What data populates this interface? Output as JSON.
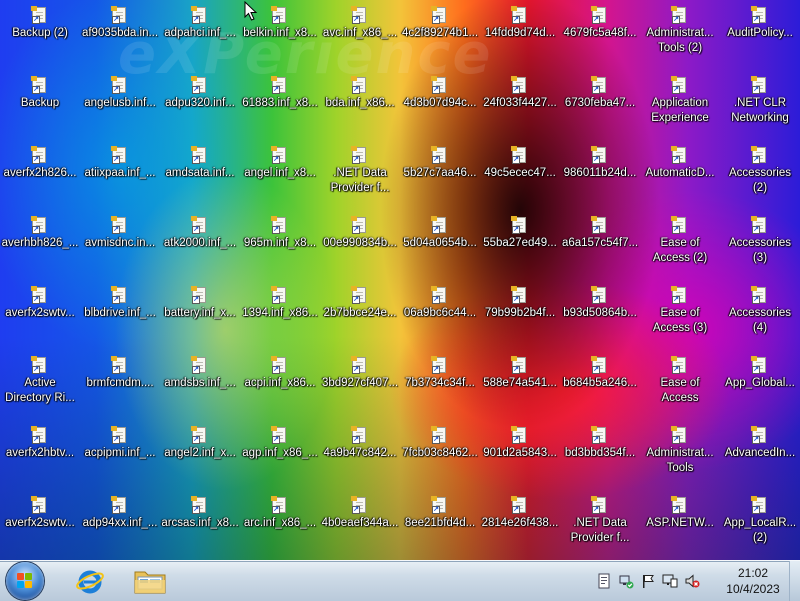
{
  "desktop": {
    "wallpaper_text": "eXPerience",
    "icons": [
      [
        "Backup (2)",
        "af9035bda.in...",
        "adpahci.inf_...",
        "belkin.inf_x8...",
        "avc.inf_x86_...",
        "4c2f89274b1...",
        "14fdd9d74d...",
        "4679fc5a48f...",
        "Administrat... Tools (2)",
        "AuditPolicy..."
      ],
      [
        "Backup",
        "angelusb.inf...",
        "adpu320.inf...",
        "61883.inf_x8...",
        "bda.inf_x86...",
        "4d3b07d94c...",
        "24f033f4427...",
        "6730feba47...",
        "Application Experience",
        ".NET CLR Networking"
      ],
      [
        "averfx2h826...",
        "atiixpaa.inf_...",
        "amdsata.inf...",
        "angel.inf_x8...",
        ".NET Data Provider f...",
        "5b27c7aa46...",
        "49c5ecec47...",
        "986011b24d...",
        "AutomaticD...",
        "Accessories (2)"
      ],
      [
        "averhbh826_...",
        "avmisdnc.in...",
        "atk2000.inf_...",
        "965m.inf_x8...",
        "00e990834b...",
        "5d04a0654b...",
        "55ba27ed49...",
        "a6a157c54f7...",
        "Ease of Access (2)",
        "Accessories (3)"
      ],
      [
        "averfx2swtv...",
        "blbdrive.inf_...",
        "battery.inf_x...",
        "1394.inf_x86...",
        "2b7bbce24e...",
        "06a9bc6c44...",
        "79b99b2b4f...",
        "b93d50864b...",
        "Ease of Access (3)",
        "Accessories (4)"
      ],
      [
        "Active Directory Ri...",
        "brmfcmdm....",
        "amdsbs.inf_...",
        "acpi.inf_x86...",
        "3bd927cf407...",
        "7b3734c34f...",
        "588e74a541...",
        "b684b5a246...",
        "Ease of Access",
        "App_Global..."
      ],
      [
        "averfx2hbtv...",
        "acpipmi.inf_...",
        "angel2.inf_x...",
        "agp.inf_x86_...",
        "4a9b47c842...",
        "7fcb03c8462...",
        "901d2a5843...",
        "bd3bbd354f...",
        "Administrat... Tools",
        "AdvancedIn..."
      ],
      [
        "averfx2swtv...",
        "adp94xx.inf_...",
        "arcsas.inf_x8...",
        "arc.inf_x86_...",
        "4b0eaef344a...",
        "8ee21bfd4d...",
        "2814e26f438...",
        ".NET Data Provider f...",
        "ASP.NETW...",
        "App_LocalR... (2)"
      ]
    ]
  },
  "taskbar": {
    "start_label": "Start",
    "pinned": [
      "internet-explorer-icon",
      "windows-explorer-icon"
    ],
    "tray_icons": [
      "action-center-icon",
      "network-icon",
      "flag-icon",
      "display-icon",
      "volume-muted-icon"
    ],
    "clock": {
      "time": "21:02",
      "date": "10/4/2023"
    }
  },
  "colors": {
    "taskbar_top": "#e9f0f6",
    "taskbar_bottom": "#b9c9da",
    "label_text": "#ffffff"
  }
}
